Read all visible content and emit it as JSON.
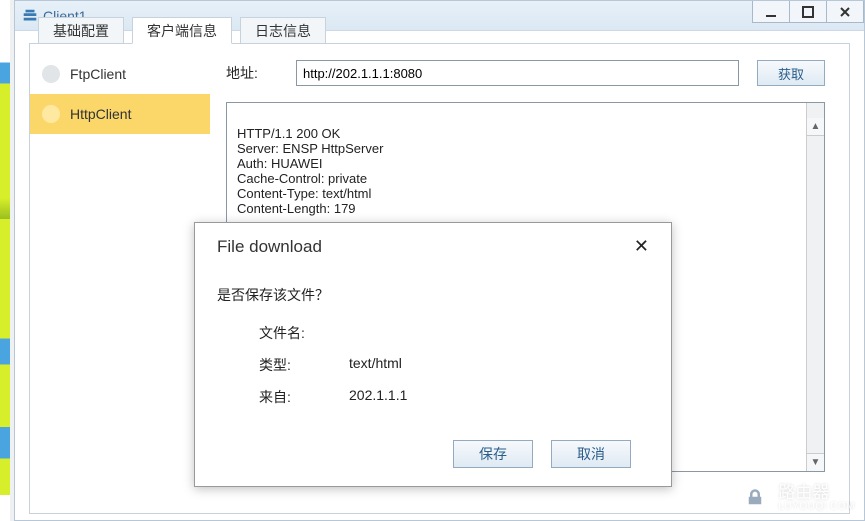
{
  "window": {
    "title": "Client1"
  },
  "tabs": [
    "基础配置",
    "客户端信息",
    "日志信息"
  ],
  "tabs_active_index": 1,
  "sidebar": {
    "items": [
      "FtpClient",
      "HttpClient"
    ],
    "active_index": 1
  },
  "address": {
    "label": "地址:",
    "value": "http://202.1.1.1:8080",
    "fetch_label": "获取"
  },
  "response_text": "HTTP/1.1 200 OK\nServer: ENSP HttpServer\nAuth: HUAWEI\nCache-Control: private\nContent-Type: text/html\nContent-Length: 179",
  "modal": {
    "title": "File download",
    "question": "是否保存该文件？",
    "filename_label": "文件名:",
    "filename_value": "",
    "type_label": "类型:",
    "type_value": "text/html",
    "from_label": "来自:",
    "from_value": "202.1.1.1",
    "save_label": "保存",
    "cancel_label": "取消"
  },
  "watermark": {
    "main": "路由器",
    "sub": "LUYOUQI.COM"
  }
}
